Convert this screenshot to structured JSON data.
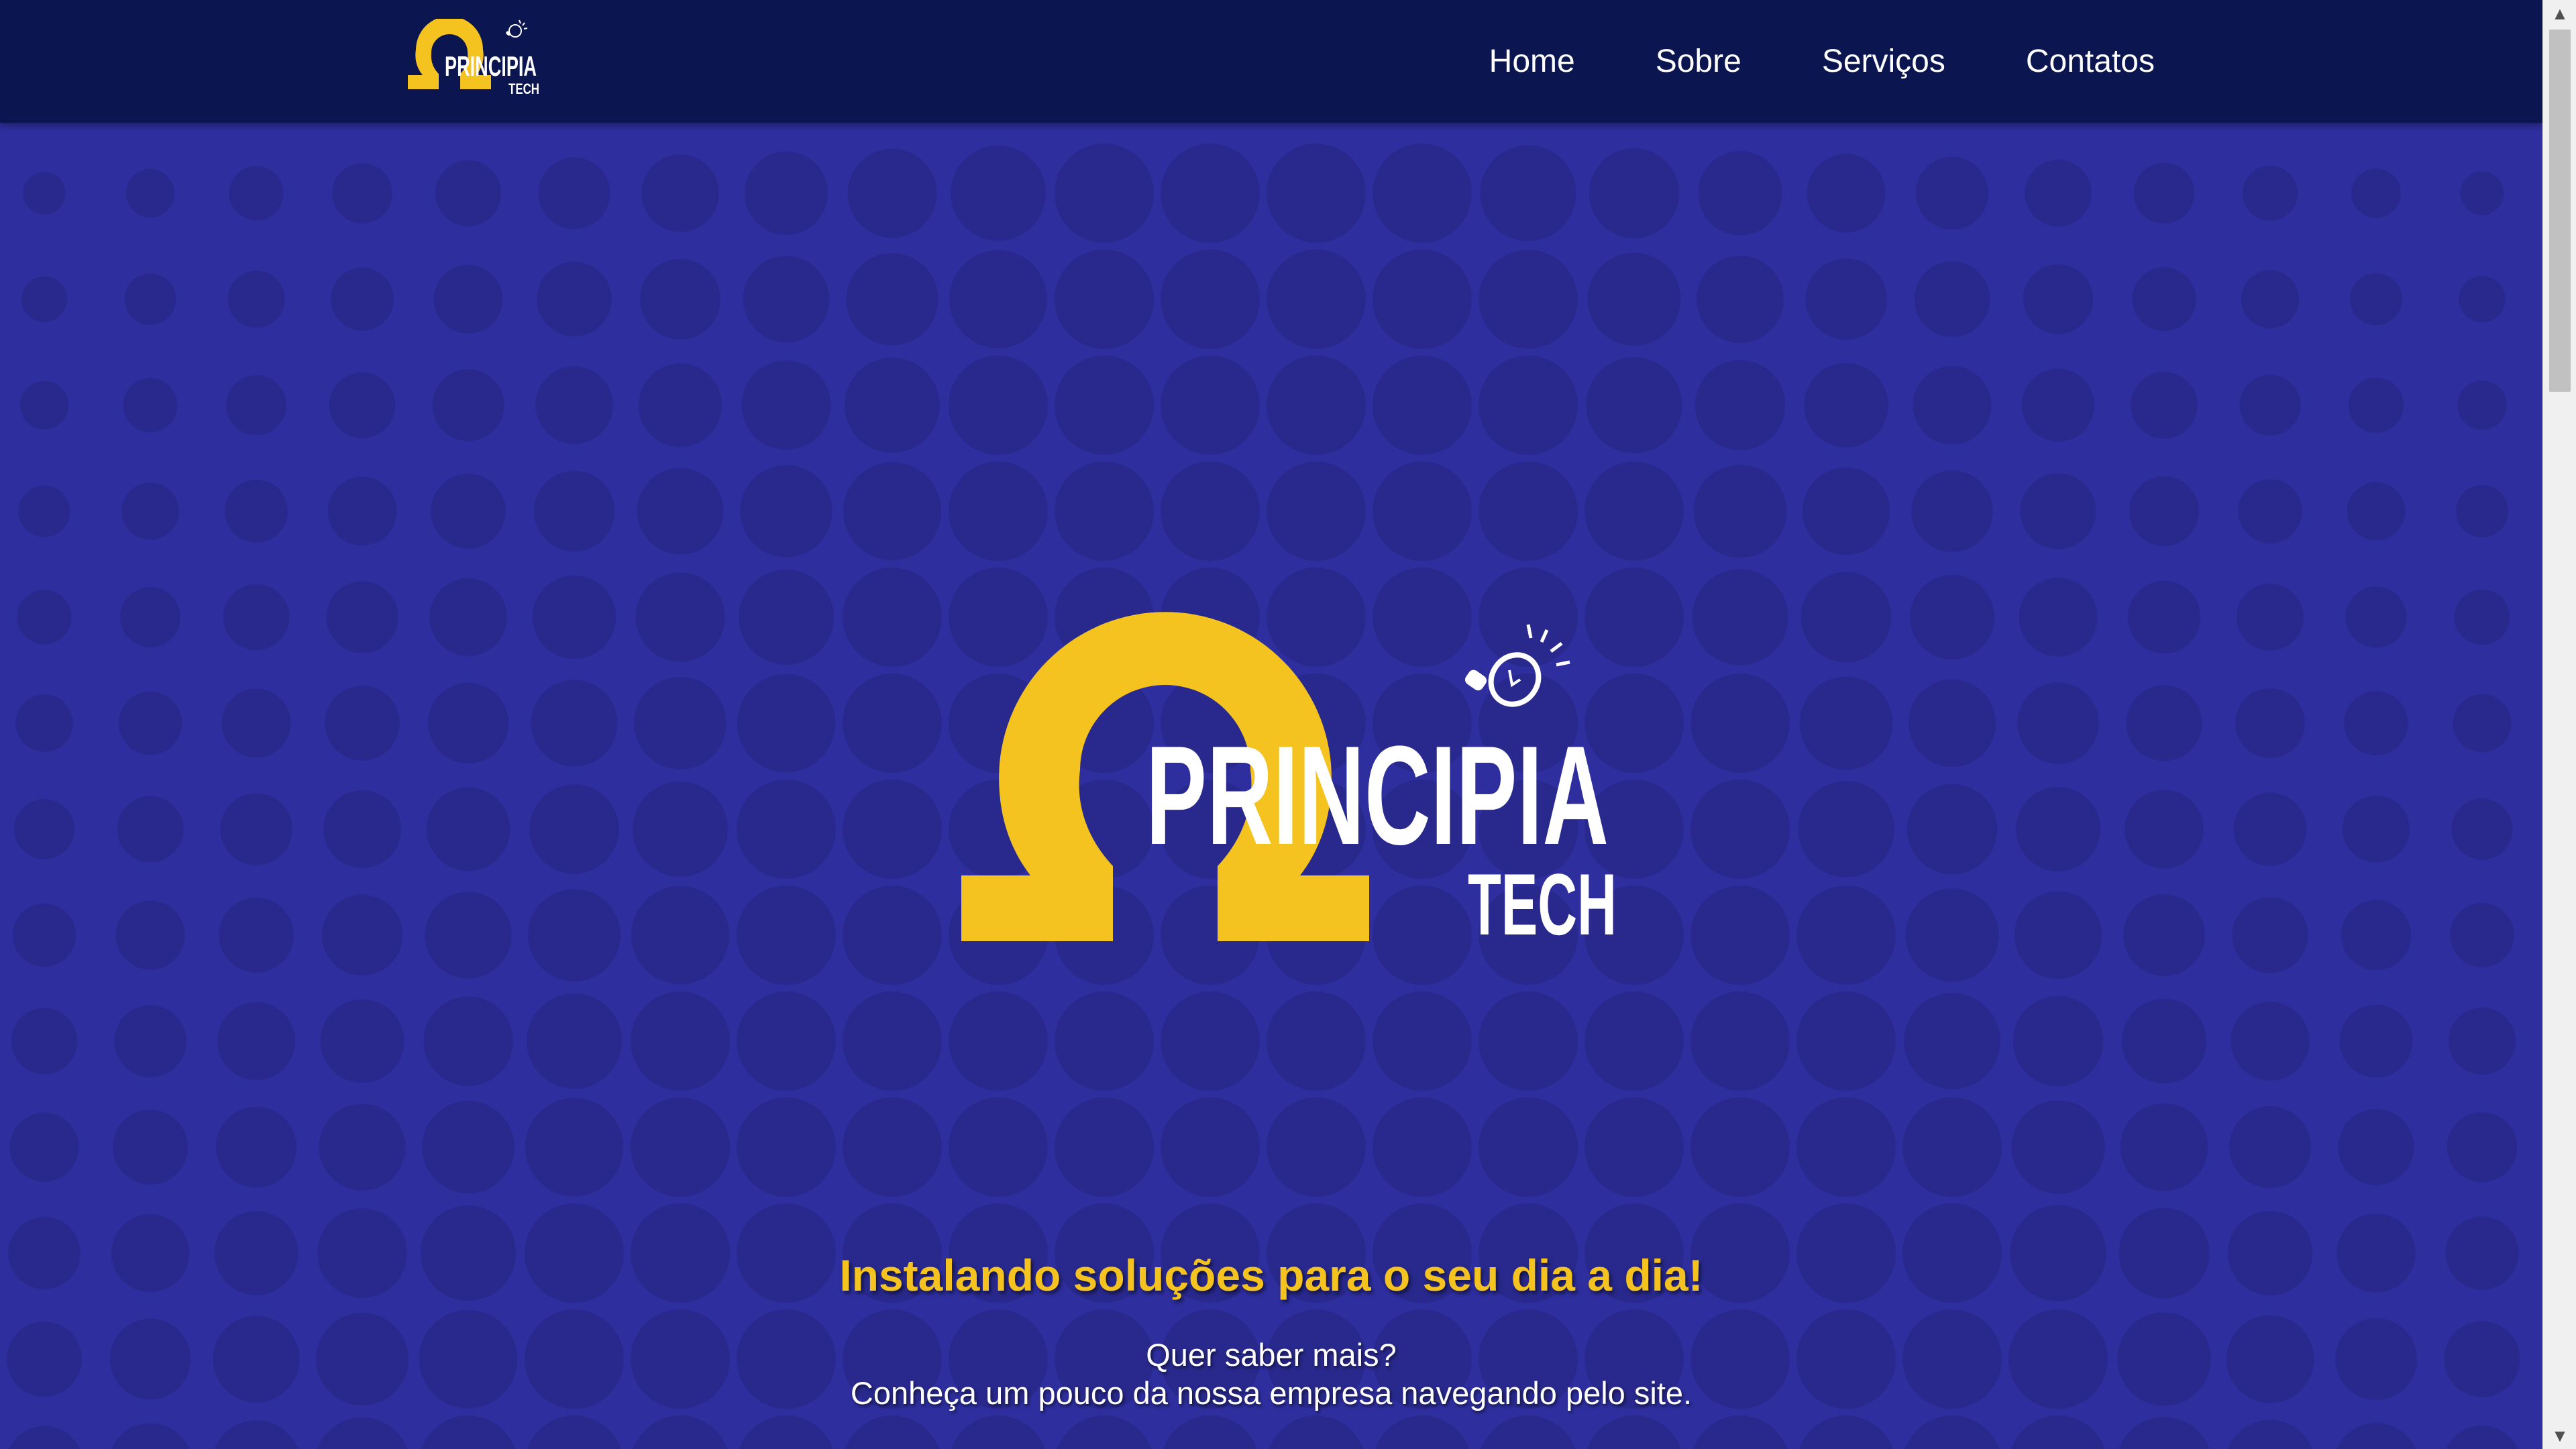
{
  "brand": {
    "name": "PRINCIPIA",
    "sub": "TECH",
    "accent_color": "#f5c320",
    "header_bg": "#0b1550",
    "hero_bg": "#2e2e9f"
  },
  "nav": {
    "items": [
      {
        "label": "Home",
        "icon": null
      },
      {
        "label": "Sobre",
        "icon": null
      },
      {
        "label": "Serviços",
        "icon": null
      },
      {
        "label": "Contatos",
        "icon": null
      }
    ]
  },
  "hero": {
    "tagline": "Instalando soluções para o seu dia a dia!",
    "sub_line1": "Quer saber mais?",
    "sub_line2": "Conheça um pouco da nossa empresa navegando pelo site."
  },
  "icons": {
    "logo_mark": "omega-icon",
    "bulb": "lightbulb-icon",
    "scroll_up": "chevron-up-icon",
    "scroll_down": "chevron-down-icon"
  }
}
